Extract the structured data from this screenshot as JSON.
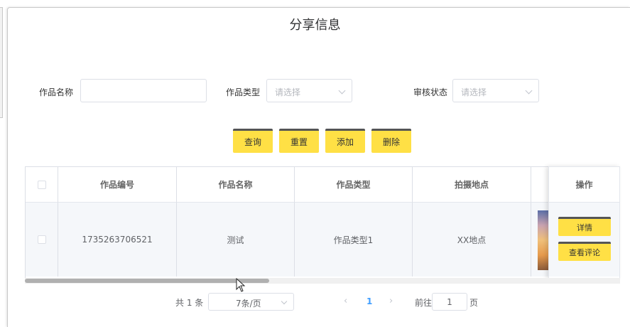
{
  "title": "分享信息",
  "search": {
    "name_label": "作品名称",
    "name_value": "",
    "type_label": "作品类型",
    "type_placeholder": "请选择",
    "status_label": "审核状态",
    "status_placeholder": "请选择"
  },
  "actions": {
    "query": "查询",
    "reset": "重置",
    "add": "添加",
    "delete": "删除"
  },
  "table": {
    "columns": [
      "作品编号",
      "作品名称",
      "作品类型",
      "拍摄地点",
      "操作"
    ],
    "rows": [
      {
        "id": "1735263706521",
        "name": "测试",
        "type": "作品类型1",
        "location": "XX地点",
        "detail_label": "详情",
        "comments_label": "查看评论"
      }
    ]
  },
  "pagination": {
    "total": "共 1 条",
    "page_size": "7条/页",
    "prev_icon": "chevron-left-icon",
    "next_icon": "chevron-right-icon",
    "current_page": "1",
    "goto_label": "前往",
    "goto_value": "1",
    "page_suffix": "页"
  },
  "colors": {
    "accent_button": "#ffe045",
    "page_active": "#409eff"
  }
}
